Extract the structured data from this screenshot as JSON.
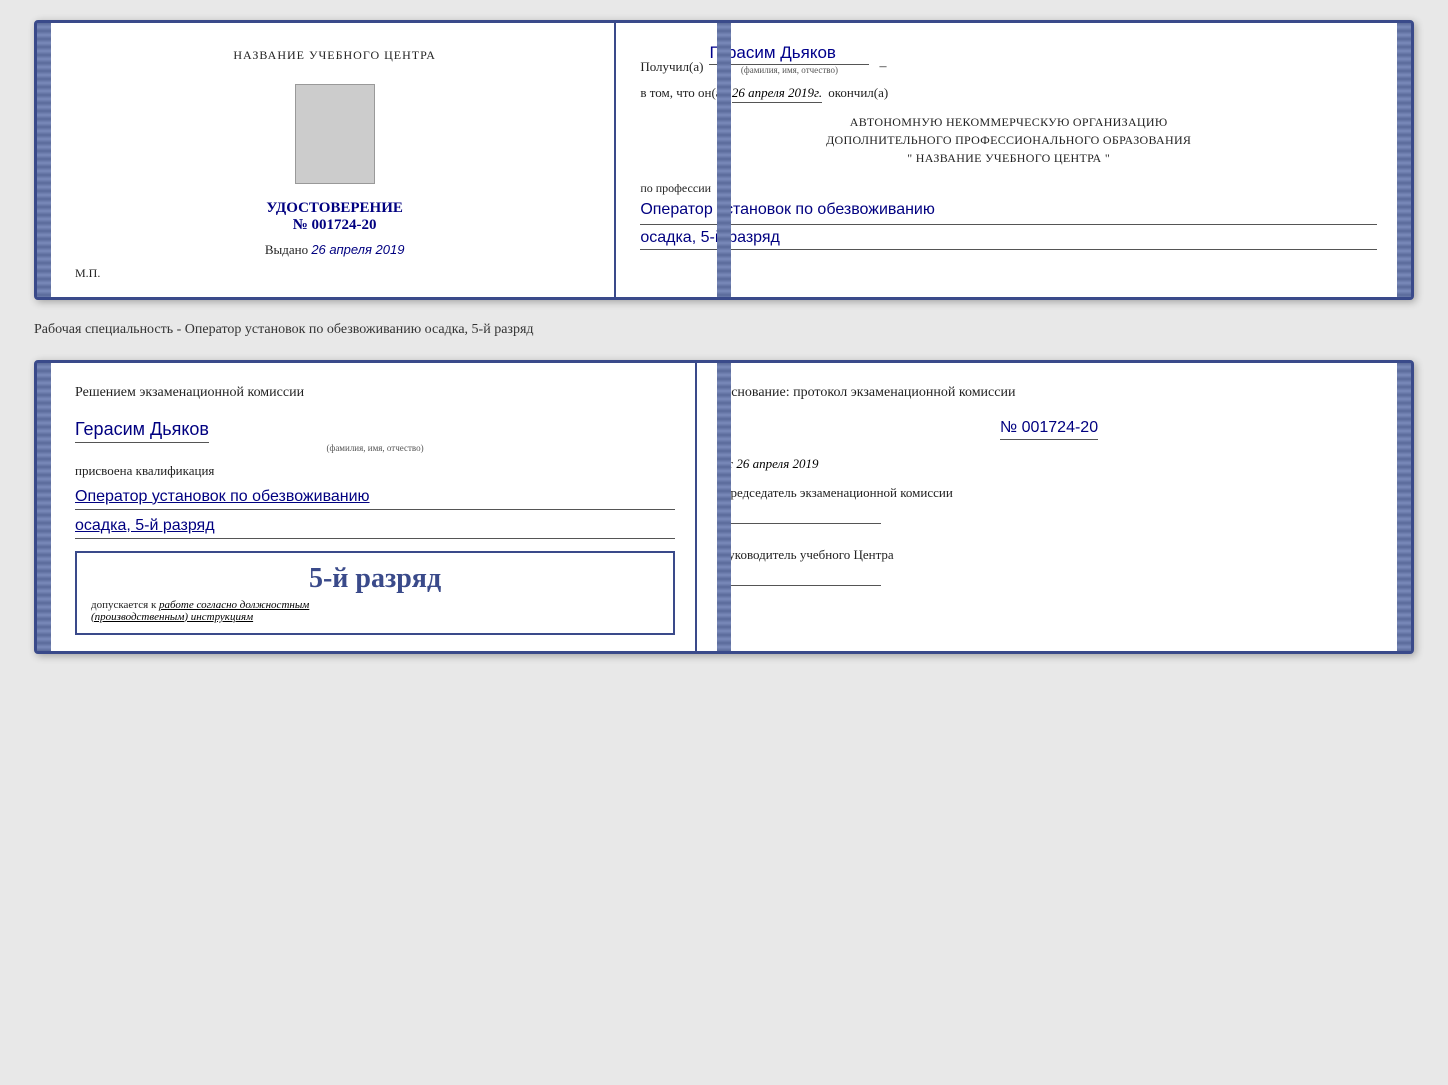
{
  "doc1": {
    "left": {
      "title": "НАЗВАНИЕ УЧЕБНОГО ЦЕНТРА",
      "cert_label": "УДОСТОВЕРЕНИЕ",
      "cert_number": "№ 001724-20",
      "issued_prefix": "Выдано",
      "issued_date": "26 апреля 2019",
      "mp_label": "М.П."
    },
    "right": {
      "received_prefix": "Получил(а)",
      "recipient_name": "Герасим Дьяков",
      "recipient_hint": "(фамилия, имя, отчество)",
      "dash": "–",
      "completion_prefix": "в том, что он(а)",
      "completion_date": "26 апреля 2019г.",
      "completion_suffix": "окончил(а)",
      "org_line1": "АВТОНОМНУЮ НЕКОММЕРЧЕСКУЮ ОРГАНИЗАЦИЮ",
      "org_line2": "ДОПОЛНИТЕЛЬНОГО ПРОФЕССИОНАЛЬНОГО ОБРАЗОВАНИЯ",
      "org_line3": "\" НАЗВАНИЕ УЧЕБНОГО ЦЕНТРА \"",
      "profession_label": "по профессии",
      "profession_value": "Оператор установок по обезвоживанию",
      "rank_value": "осадка, 5-й разряд"
    }
  },
  "separator": {
    "text": "Рабочая специальность - Оператор установок по обезвоживанию осадка, 5-й разряд"
  },
  "doc2": {
    "left": {
      "commission_title": "Решением экзаменационной комиссии",
      "person_name": "Герасим Дьяков",
      "person_hint": "(фамилия, имя, отчество)",
      "assigned_label": "присвоена квалификация",
      "qual_line1": "Оператор установок по обезвоживанию",
      "qual_line2": "осадка, 5-й разряд",
      "stamp_rank": "5-й разряд",
      "allowed_prefix": "допускается к",
      "allowed_value": "работе согласно должностным",
      "allowed_value2": "(производственным) инструкциям"
    },
    "right": {
      "basis_title": "Основание: протокол экзаменационной комиссии",
      "protocol_number": "№ 001724-20",
      "date_prefix": "от",
      "date_value": "26 апреля 2019",
      "chairman_title": "Председатель экзаменационной комиссии",
      "head_title": "Руководитель учебного Центра"
    }
  }
}
